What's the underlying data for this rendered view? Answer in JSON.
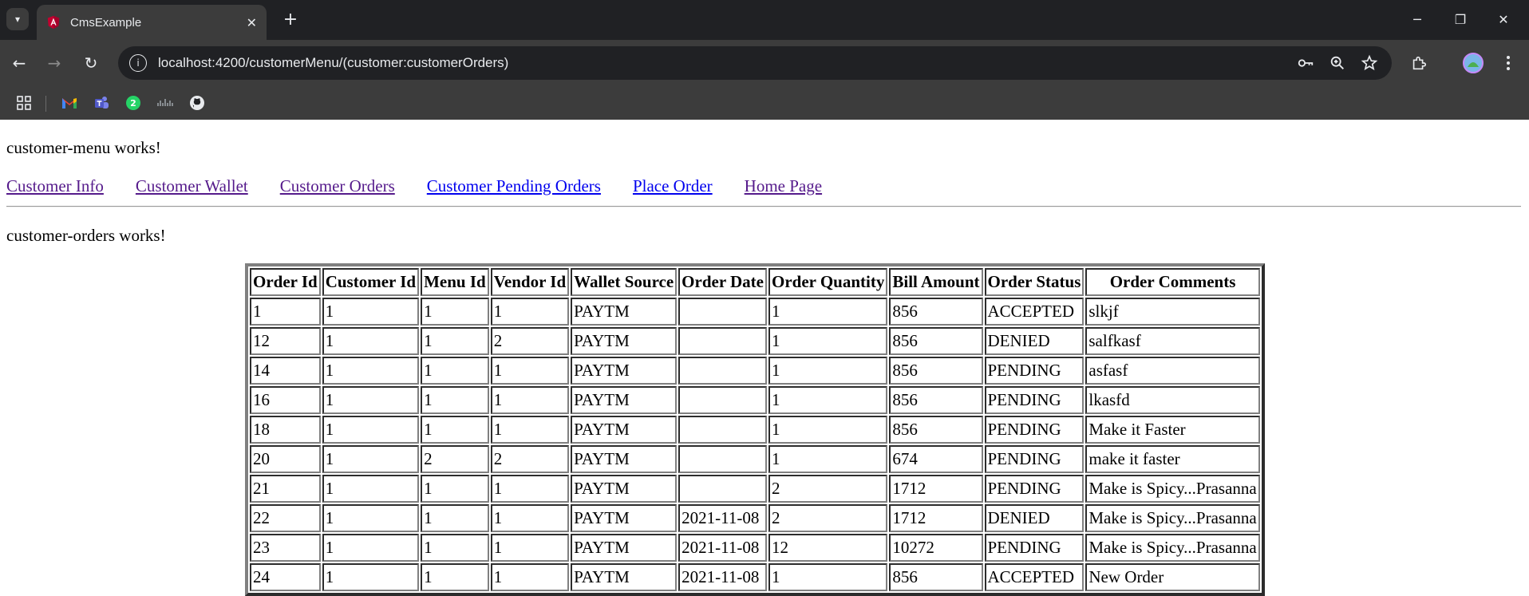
{
  "browser": {
    "tab": {
      "title": "CmsExample"
    },
    "url": "localhost:4200/customerMenu/(customer:customerOrders)",
    "bookmarks": [
      {
        "icon": "apps-grid-icon"
      },
      {
        "icon": "gmail-icon"
      },
      {
        "icon": "teams-icon"
      },
      {
        "icon": "whatsapp-icon",
        "badge": "2"
      },
      {
        "icon": "cisco-icon"
      },
      {
        "icon": "github-icon"
      }
    ],
    "colors": {
      "tabstrip": "#202124",
      "toolbar": "#3c3c3c",
      "omnibox": "#202124"
    }
  },
  "page": {
    "menu_text": "customer-menu works!",
    "nav_links": [
      {
        "label": "Customer Info"
      },
      {
        "label": "Customer Wallet"
      },
      {
        "label": "Customer Orders"
      },
      {
        "label": "Customer Pending Orders"
      },
      {
        "label": "Place Order"
      },
      {
        "label": "Home Page"
      }
    ],
    "orders_text": "customer-orders works!",
    "table": {
      "headers": [
        "Order Id",
        "Customer Id",
        "Menu Id",
        "Vendor Id",
        "Wallet Source",
        "Order Date",
        "Order Quantity",
        "Bill Amount",
        "Order Status",
        "Order Comments"
      ],
      "rows": [
        [
          "1",
          "1",
          "1",
          "1",
          "PAYTM",
          "",
          "1",
          "856",
          "ACCEPTED",
          "slkjf"
        ],
        [
          "12",
          "1",
          "1",
          "2",
          "PAYTM",
          "",
          "1",
          "856",
          "DENIED",
          "salfkasf"
        ],
        [
          "14",
          "1",
          "1",
          "1",
          "PAYTM",
          "",
          "1",
          "856",
          "PENDING",
          "asfasf"
        ],
        [
          "16",
          "1",
          "1",
          "1",
          "PAYTM",
          "",
          "1",
          "856",
          "PENDING",
          "lkasfd"
        ],
        [
          "18",
          "1",
          "1",
          "1",
          "PAYTM",
          "",
          "1",
          "856",
          "PENDING",
          "Make it Faster"
        ],
        [
          "20",
          "1",
          "2",
          "2",
          "PAYTM",
          "",
          "1",
          "674",
          "PENDING",
          "make it faster"
        ],
        [
          "21",
          "1",
          "1",
          "1",
          "PAYTM",
          "",
          "2",
          "1712",
          "PENDING",
          "Make is Spicy...Prasanna"
        ],
        [
          "22",
          "1",
          "1",
          "1",
          "PAYTM",
          "2021-11-08",
          "2",
          "1712",
          "DENIED",
          "Make is Spicy...Prasanna"
        ],
        [
          "23",
          "1",
          "1",
          "1",
          "PAYTM",
          "2021-11-08",
          "12",
          "10272",
          "PENDING",
          "Make is Spicy...Prasanna"
        ],
        [
          "24",
          "1",
          "1",
          "1",
          "PAYTM",
          "2021-11-08",
          "1",
          "856",
          "ACCEPTED",
          "New Order"
        ]
      ]
    }
  }
}
